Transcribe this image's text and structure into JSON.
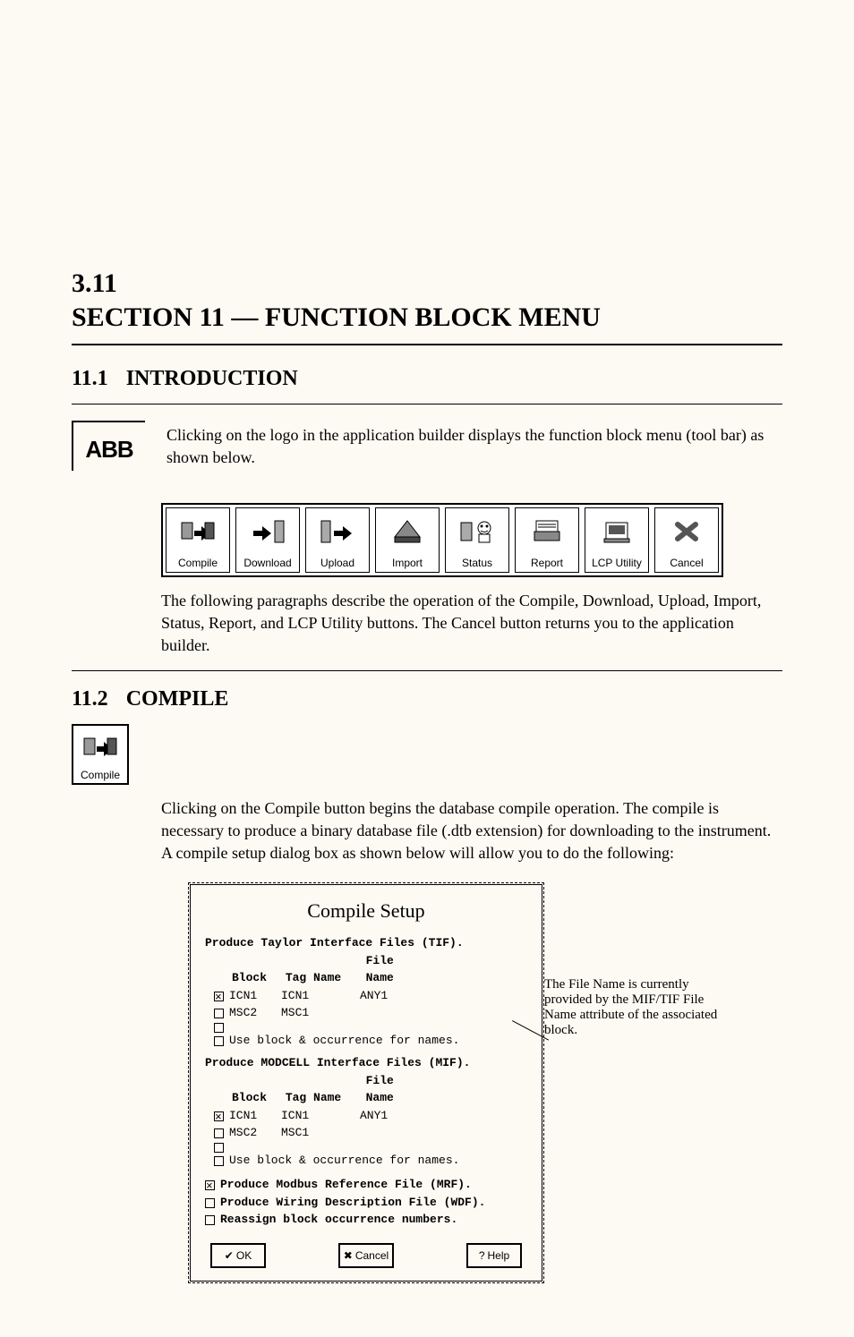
{
  "section": {
    "number": "3.11",
    "title": "SECTION 11 — FUNCTION BLOCK MENU"
  },
  "subsection1": {
    "number": "11.1",
    "title": "INTRODUCTION",
    "para1": "Clicking on the logo in the application builder displays the function block menu (tool bar) as shown below.",
    "para2": "The following paragraphs describe the operation of the Compile, Download, Upload, Import, Status, Report, and LCP Utility buttons. The Cancel button returns you to the application builder."
  },
  "subsection2": {
    "number": "11.2",
    "title": "COMPILE",
    "para1": "Clicking on the Compile button begins the database compile operation. The compile is necessary to produce a binary database file (.dtb extension) for downloading to the instrument. A compile setup dialog box as shown below will allow you to do the following:"
  },
  "toolbar": [
    {
      "label": "Compile",
      "icon": "compile-icon"
    },
    {
      "label": "Download",
      "icon": "download-icon"
    },
    {
      "label": "Upload",
      "icon": "upload-icon"
    },
    {
      "label": "Import",
      "icon": "import-icon"
    },
    {
      "label": "Status",
      "icon": "status-icon"
    },
    {
      "label": "Report",
      "icon": "report-icon"
    },
    {
      "label": "LCP Utility",
      "icon": "lcp-utility-icon"
    },
    {
      "label": "Cancel",
      "icon": "cancel-icon"
    }
  ],
  "compile_button": {
    "label": "Compile"
  },
  "dialog": {
    "title": "Compile Setup",
    "tif_header": "Produce Taylor Interface Files (TIF).",
    "col_block": "Block",
    "col_tag": "Tag Name",
    "col_file": "File Name",
    "tif_rows": [
      {
        "checked": true,
        "block": "ICN1",
        "tag": "ICN1",
        "file": "ANY1"
      },
      {
        "checked": false,
        "block": "MSC2",
        "tag": "MSC1",
        "file": ""
      },
      {
        "checked": false,
        "block": "",
        "tag": "",
        "file": ""
      }
    ],
    "tif_use_block": {
      "checked": false,
      "label": "Use block & occurrence for names."
    },
    "mif_header": "Produce MODCELL Interface Files (MIF).",
    "mif_rows": [
      {
        "checked": true,
        "block": "ICN1",
        "tag": "ICN1",
        "file": "ANY1"
      },
      {
        "checked": false,
        "block": "MSC2",
        "tag": "MSC1",
        "file": ""
      },
      {
        "checked": false,
        "block": "",
        "tag": "",
        "file": ""
      }
    ],
    "mif_use_block": {
      "checked": false,
      "label": "Use block & occurrence for names."
    },
    "produce_mrf": {
      "checked": true,
      "label": "Produce Modbus Reference File (MRF)."
    },
    "produce_wdf": {
      "checked": false,
      "label": "Produce Wiring Description File (WDF)."
    },
    "reassign": {
      "checked": false,
      "label": "Reassign block occurrence numbers."
    },
    "buttons": {
      "ok": "OK",
      "cancel": "Cancel",
      "help": "Help"
    }
  },
  "callout": "The File Name is currently provided by the MIF/TIF File Name attribute of the associated block.",
  "logo_text": "ABB"
}
